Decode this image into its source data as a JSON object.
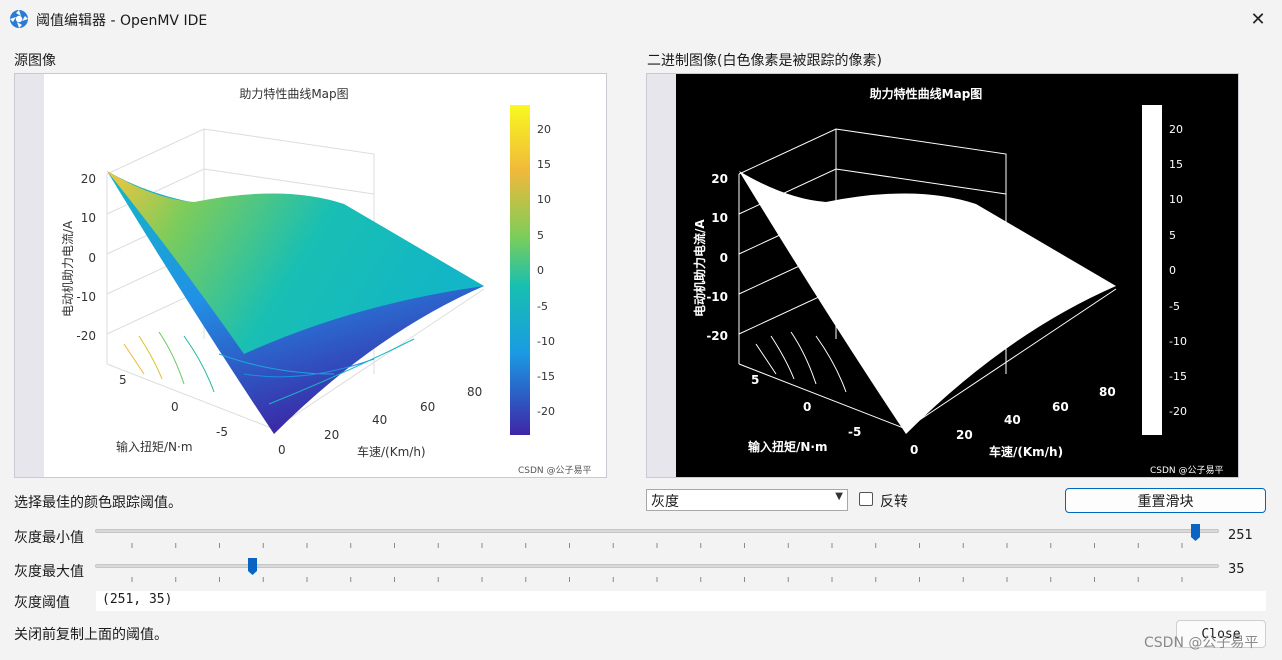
{
  "window": {
    "title": "阈值编辑器 - OpenMV IDE",
    "close_glyph": "✕"
  },
  "panels": {
    "source": {
      "label": "源图像",
      "plot": {
        "title": "助力特性曲线Map图",
        "zlabel": "电动机助力电流/A",
        "xlabel": "车速/(Km/h)",
        "ylabel": "输入扭矩/N·m",
        "z_ticks": [
          "20",
          "10",
          "0",
          "-10",
          "-20"
        ],
        "torque_ticks": [
          "5",
          "0",
          "-5"
        ],
        "speed_ticks": [
          "0",
          "20",
          "40",
          "60",
          "80"
        ],
        "colorbar_ticks": [
          "20",
          "15",
          "10",
          "5",
          "0",
          "-5",
          "-10",
          "-15",
          "-20"
        ],
        "credit": "CSDN @公子易平"
      }
    },
    "binary": {
      "label": "二进制图像(白色像素是被跟踪的像素)"
    }
  },
  "controls": {
    "hint": "选择最佳的颜色跟踪阈值。",
    "color_mode": "灰度",
    "invert_label": "反转",
    "reset_button": "重置滑块"
  },
  "sliders": {
    "min": {
      "label": "灰度最小值",
      "value": "251",
      "fraction": 0.984
    },
    "max": {
      "label": "灰度最大值",
      "value": "35",
      "fraction": 0.137
    }
  },
  "threshold": {
    "label": "灰度阈值",
    "value": "(251, 35)"
  },
  "footer": {
    "note": "关闭前复制上面的阈值。",
    "close_button": "Close",
    "watermark": "CSDN @公子易平"
  },
  "colors": {
    "accent": "#0067c0",
    "slider_thumb": "#0a64c4",
    "window_bg": "#f3f3f3"
  }
}
